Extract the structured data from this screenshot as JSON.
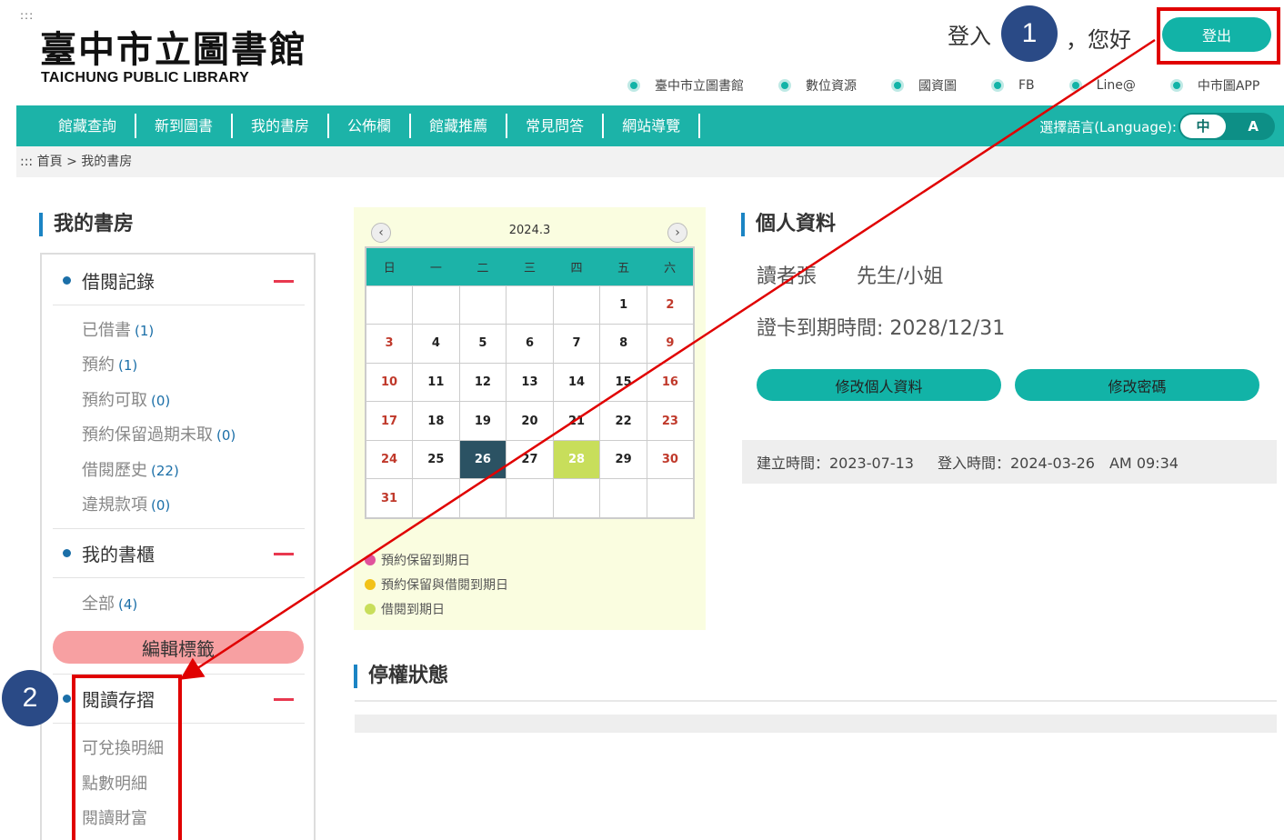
{
  "header": {
    "skip_dots": ":::",
    "logo_cn": "臺中市立圖書館",
    "logo_en": "TAICHUNG PUBLIC LIBRARY",
    "login_text": "登入",
    "hello_text": "，您好",
    "logout_label": "登出",
    "quicklinks": [
      "臺中市立圖書館",
      "數位資源",
      "國資圖",
      "FB",
      "Line@",
      "中市圖APP"
    ]
  },
  "annotations": {
    "step1": "1",
    "step2": "2",
    "highlight_color": "#e00000",
    "circle_color": "#2a4a86"
  },
  "nav": {
    "items": [
      "館藏查詢",
      "新到圖書",
      "我的書房",
      "公佈欄",
      "館藏推薦",
      "常見問答",
      "網站導覽"
    ],
    "lang_label": "選擇語言(Language):",
    "lang_zh": "中",
    "lang_en": "A",
    "accent": "#1cb3a8"
  },
  "breadcrumb": {
    "dots": ":::",
    "home": "首頁",
    "sep": ">",
    "current": "我的書房"
  },
  "sidebar": {
    "title": "我的書房",
    "borrow": {
      "label": "借閱記錄",
      "items": [
        {
          "label": "已借書",
          "count": "(1)"
        },
        {
          "label": "預約",
          "count": "(1)"
        },
        {
          "label": "預約可取",
          "count": "(0)"
        },
        {
          "label": "預約保留過期未取",
          "count": "(0)"
        },
        {
          "label": "借閱歷史",
          "count": "(22)"
        },
        {
          "label": "違規款項",
          "count": "(0)"
        }
      ]
    },
    "shelf": {
      "label": "我的書櫃",
      "items": [
        {
          "label": "全部",
          "count": "(4)"
        }
      ],
      "edit_tags": "編輯標籤"
    },
    "passbook": {
      "label": "閱讀存摺",
      "items": [
        "可兌換明細",
        "點數明細",
        "閱讀財富"
      ]
    }
  },
  "calendar": {
    "prev": "‹",
    "next": "›",
    "title": "2024.3",
    "weekdays": [
      "日",
      "一",
      "二",
      "三",
      "四",
      "五",
      "六"
    ],
    "weeks": [
      [
        "",
        "",
        "",
        "",
        "",
        "1",
        "2"
      ],
      [
        "3",
        "4",
        "5",
        "6",
        "7",
        "8",
        "9"
      ],
      [
        "10",
        "11",
        "12",
        "13",
        "14",
        "15",
        "16"
      ],
      [
        "17",
        "18",
        "19",
        "20",
        "21",
        "22",
        "23"
      ],
      [
        "24",
        "25",
        "26",
        "27",
        "28",
        "29",
        "30"
      ],
      [
        "31",
        "",
        "",
        "",
        "",
        "",
        ""
      ]
    ],
    "today": "26",
    "highlighted": "28",
    "legend": [
      {
        "label": "預約保留到期日",
        "color": "#e0529c"
      },
      {
        "label": "預約保留與借閱到期日",
        "color": "#f2c218"
      },
      {
        "label": "借閱到期日",
        "color": "#c8de5b"
      }
    ]
  },
  "profile": {
    "title": "個人資料",
    "name": "讀者張",
    "honorific": "先生/小姐",
    "card_expiry": "證卡到期時間: 2028/12/31",
    "edit_profile": "修改個人資料",
    "edit_password": "修改密碼",
    "created": "建立時間：2023-07-13",
    "login_time": "登入時間：2024-03-26　AM 09:34"
  },
  "suspension": {
    "title": "停權狀態"
  }
}
